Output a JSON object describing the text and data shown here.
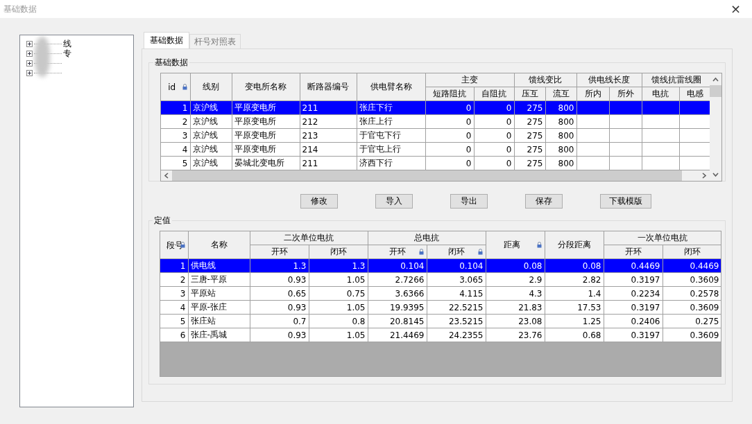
{
  "window": {
    "title": "基础数据",
    "close": "×"
  },
  "tree": {
    "items": [
      {
        "label": "线",
        "expanded": false
      },
      {
        "label": "专",
        "expanded": false
      },
      {
        "expanded": false
      },
      {
        "expanded": false
      }
    ]
  },
  "tabs": [
    {
      "label": "基础数据",
      "selected": true
    },
    {
      "label": "杆号对照表",
      "selected": false
    }
  ],
  "basic_group": {
    "title": "基础数据",
    "table": {
      "headers": [
        {
          "label": "id",
          "locked": true,
          "kind": "number"
        },
        {
          "label": "线别",
          "locked": false,
          "kind": "text"
        },
        {
          "label": "变电所名称",
          "locked": false,
          "kind": "text"
        },
        {
          "label": "断路器编号",
          "locked": false,
          "kind": "text"
        },
        {
          "label": "供电臂名称",
          "locked": false,
          "kind": "text"
        },
        {
          "label": "主变",
          "children": [
            {
              "label": "短路阻抗",
              "locked": false,
              "kind": "number"
            },
            {
              "label": "自阻抗",
              "locked": false,
              "kind": "number"
            }
          ]
        },
        {
          "label": "馈线变比",
          "children": [
            {
              "label": "压互",
              "locked": false,
              "kind": "number"
            },
            {
              "label": "流互",
              "locked": false,
              "kind": "number"
            }
          ]
        },
        {
          "label": "供电线长度",
          "children": [
            {
              "label": "所内",
              "locked": false,
              "kind": "number"
            },
            {
              "label": "所外",
              "locked": false,
              "kind": "number"
            }
          ]
        },
        {
          "label": "馈线抗雷线圈",
          "children": [
            {
              "label": "电抗",
              "locked": false,
              "kind": "number"
            },
            {
              "label": "电感",
              "locked": false,
              "kind": "number"
            }
          ]
        }
      ],
      "rows": [
        {
          "selected": true,
          "cells": [
            "1",
            "京沪线",
            "平原变电所",
            "211",
            "张庄下行",
            "0",
            "0",
            "275",
            "800"
          ]
        },
        {
          "selected": false,
          "cells": [
            "2",
            "京沪线",
            "平原变电所",
            "212",
            "张庄上行",
            "0",
            "0",
            "275",
            "800"
          ]
        },
        {
          "selected": false,
          "cells": [
            "3",
            "京沪线",
            "平原变电所",
            "213",
            "于官屯下行",
            "0",
            "0",
            "275",
            "800"
          ]
        },
        {
          "selected": false,
          "cells": [
            "4",
            "京沪线",
            "平原变电所",
            "214",
            "于官屯上行",
            "0",
            "0",
            "275",
            "800"
          ]
        },
        {
          "selected": false,
          "cells": [
            "5",
            "京沪线",
            "晏城北变电所",
            "211",
            "济西下行",
            "0",
            "0",
            "275",
            "800"
          ]
        }
      ]
    }
  },
  "buttons": [
    "修改",
    "导入",
    "导出",
    "保存",
    "下载模版"
  ],
  "setpoint_group": {
    "title": "定值",
    "table": {
      "headers": [
        {
          "label": "段号",
          "locked": true,
          "kind": "number"
        },
        {
          "label": "名称",
          "locked": false,
          "kind": "text"
        },
        {
          "label": "二次单位电抗",
          "children": [
            {
              "label": "开环",
              "locked": false,
              "kind": "number"
            },
            {
              "label": "闭环",
              "locked": false,
              "kind": "number"
            }
          ]
        },
        {
          "label": "总电抗",
          "children": [
            {
              "label": "开环",
              "locked": true,
              "kind": "number"
            },
            {
              "label": "闭环",
              "locked": true,
              "kind": "number"
            }
          ]
        },
        {
          "label": "距离",
          "locked": true,
          "kind": "number"
        },
        {
          "label": "分段距离",
          "locked": false,
          "kind": "number"
        },
        {
          "label": "一次单位电抗",
          "children": [
            {
              "label": "开环",
              "locked": false,
              "kind": "number"
            },
            {
              "label": "闭环",
              "locked": false,
              "kind": "number"
            }
          ]
        }
      ],
      "rows": [
        {
          "selected": true,
          "cells": [
            "1",
            "供电线",
            "1.3",
            "1.3",
            "0.104",
            "0.104",
            "0.08",
            "0.08",
            "0.4469",
            "0.4469"
          ]
        },
        {
          "selected": false,
          "cells": [
            "2",
            "三唐-平原",
            "0.93",
            "1.05",
            "2.7266",
            "3.065",
            "2.9",
            "2.82",
            "0.3197",
            "0.3609"
          ]
        },
        {
          "selected": false,
          "cells": [
            "3",
            "平原站",
            "0.65",
            "0.75",
            "3.6366",
            "4.115",
            "4.3",
            "1.4",
            "0.2234",
            "0.2578"
          ]
        },
        {
          "selected": false,
          "cells": [
            "4",
            "平原-张庄",
            "0.93",
            "1.05",
            "19.9395",
            "22.5215",
            "21.83",
            "17.53",
            "0.3197",
            "0.3609"
          ]
        },
        {
          "selected": false,
          "cells": [
            "5",
            "张庄站",
            "0.7",
            "0.8",
            "20.8145",
            "23.5215",
            "23.08",
            "1.25",
            "0.2406",
            "0.275"
          ]
        },
        {
          "selected": false,
          "cells": [
            "6",
            "张庄-禹城",
            "0.93",
            "1.05",
            "21.4469",
            "24.2355",
            "23.76",
            "0.68",
            "0.3197",
            "0.3609"
          ]
        }
      ]
    }
  }
}
